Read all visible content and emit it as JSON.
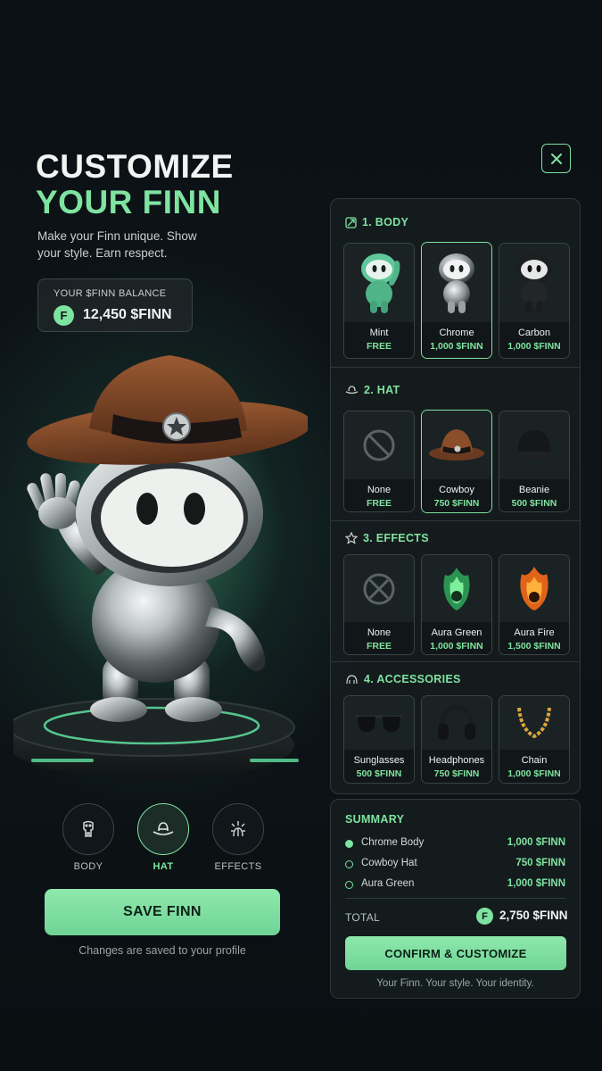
{
  "hero": {
    "title_line1": "CUSTOMIZE",
    "title_line2": "YOUR FINN",
    "subtitle": "Make your Finn unique. Show your style. Earn respect."
  },
  "balance": {
    "label": "YOUR $FINN BALANCE",
    "coin_symbol": "F",
    "value": "12,450 $FINN"
  },
  "tabs": [
    {
      "label": "BODY",
      "icon": "body-icon",
      "active": false
    },
    {
      "label": "HAT",
      "icon": "hat-icon",
      "active": true
    },
    {
      "label": "EFFECTS",
      "icon": "effects-icon",
      "active": false
    }
  ],
  "save": {
    "label": "SAVE FINN",
    "note": "Changes are saved to your profile"
  },
  "panel": {
    "sections": [
      {
        "title": "1. BODY",
        "icon": "leaf-icon",
        "items": [
          {
            "name": "Mint",
            "price": "FREE",
            "selected": false
          },
          {
            "name": "Chrome",
            "price": "1,000 $FINN",
            "selected": true
          },
          {
            "name": "Carbon",
            "price": "1,000 $FINN",
            "selected": false
          }
        ]
      },
      {
        "title": "2. HAT",
        "icon": "hat-icon",
        "items": [
          {
            "name": "None",
            "price": "FREE",
            "selected": false
          },
          {
            "name": "Cowboy",
            "price": "750 $FINN",
            "selected": true
          },
          {
            "name": "Beanie",
            "price": "500 $FINN",
            "selected": false
          }
        ]
      },
      {
        "title": "3. EFFECTS",
        "icon": "star-icon",
        "items": [
          {
            "name": "None",
            "price": "FREE",
            "selected": false
          },
          {
            "name": "Aura Green",
            "price": "1,000 $FINN",
            "selected": false
          },
          {
            "name": "Aura Fire",
            "price": "1,500 $FINN",
            "selected": false
          }
        ]
      },
      {
        "title": "4. ACCESSORIES",
        "icon": "accessories-icon",
        "items": [
          {
            "name": "Sunglasses",
            "price": "500 $FINN",
            "selected": false
          },
          {
            "name": "Headphones",
            "price": "750 $FINN",
            "selected": false
          },
          {
            "name": "Chain",
            "price": "1,000 $FINN",
            "selected": false
          }
        ]
      }
    ]
  },
  "summary": {
    "title": "SUMMARY",
    "rows": [
      {
        "name": "Chrome Body",
        "price": "1,000 $FINN",
        "filled": true
      },
      {
        "name": "Cowboy Hat",
        "price": "750 $FINN",
        "filled": false
      },
      {
        "name": "Aura Green",
        "price": "1,000 $FINN",
        "filled": false
      }
    ],
    "total_label": "TOTAL",
    "total_coin": "F",
    "total_value": "2,750 $FINN",
    "confirm_label": "CONFIRM & CUSTOMIZE",
    "tagline": "Your Finn. Your style. Your identity."
  },
  "colors": {
    "accent": "#7fe3a0",
    "background": "#0b1014",
    "panel": "#161c1e"
  }
}
